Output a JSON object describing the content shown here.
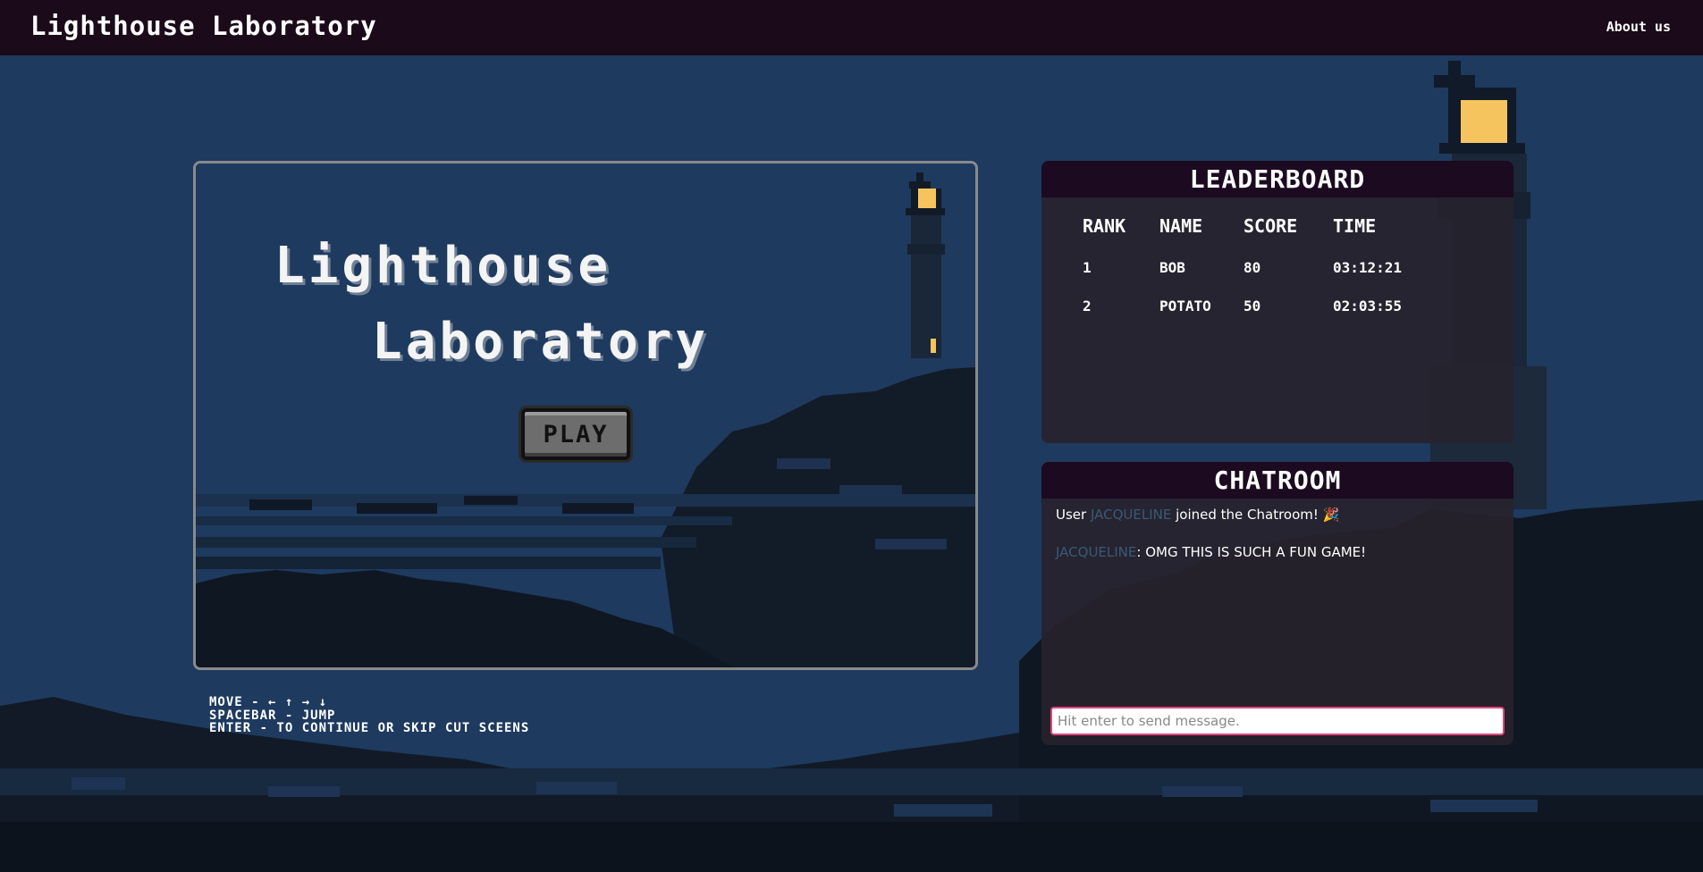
{
  "nav": {
    "brand": "Lighthouse Laboratory",
    "about_link": "About us"
  },
  "game": {
    "title_line1": "Lighthouse",
    "title_line2": "Laboratory",
    "play_label": "PLAY"
  },
  "controls": {
    "lines": [
      "MOVE - ← ↑ → ↓",
      "SPACEBAR - JUMP",
      "ENTER - TO CONTINUE OR SKIP CUT SCEENS"
    ]
  },
  "leaderboard": {
    "title": "LEADERBOARD",
    "columns": [
      "RANK",
      "NAME",
      "SCORE",
      "TIME"
    ],
    "rows": [
      {
        "rank": "1",
        "name": "BOB",
        "score": "80",
        "time": "03:12:21"
      },
      {
        "rank": "2",
        "name": "POTATO",
        "score": "50",
        "time": "02:03:55"
      }
    ]
  },
  "chatroom": {
    "title": "CHATROOM",
    "messages": [
      {
        "prefix": "User ",
        "user": "JACQUELINE",
        "text": " joined the Chatroom! 🎉"
      },
      {
        "prefix": "",
        "user": "JACQUELINE",
        "text": ": OMG THIS IS SUCH A FUN GAME!"
      }
    ],
    "input_placeholder": "Hit enter to send message."
  },
  "colors": {
    "sky": "#1e3a5f",
    "nav_bg": "#1a0a1a",
    "panel_head": "#1c0a20",
    "lamp": "#f5c45e",
    "input_border": "#e0457b",
    "chat_username": "#3b5878"
  }
}
